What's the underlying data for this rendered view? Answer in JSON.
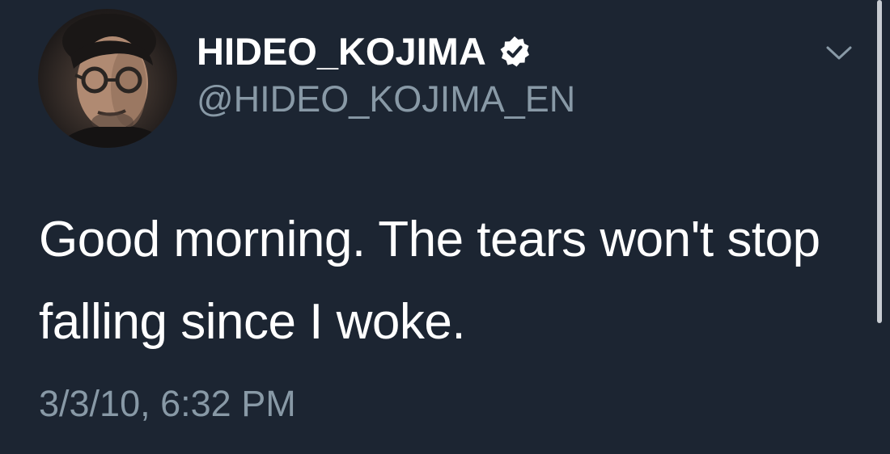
{
  "author": {
    "display_name": "HIDEO_KOJIMA",
    "handle": "@HIDEO_KOJIMA_EN",
    "verified": true
  },
  "tweet": {
    "text": "Good morning. The tears won't stop falling since I woke.",
    "timestamp": "3/3/10, 6:32 PM"
  },
  "icons": {
    "verified": "verified-badge-icon",
    "menu": "chevron-down-icon"
  },
  "colors": {
    "background": "#1c2532",
    "primary_text": "#ffffff",
    "secondary_text": "#8899a6"
  }
}
